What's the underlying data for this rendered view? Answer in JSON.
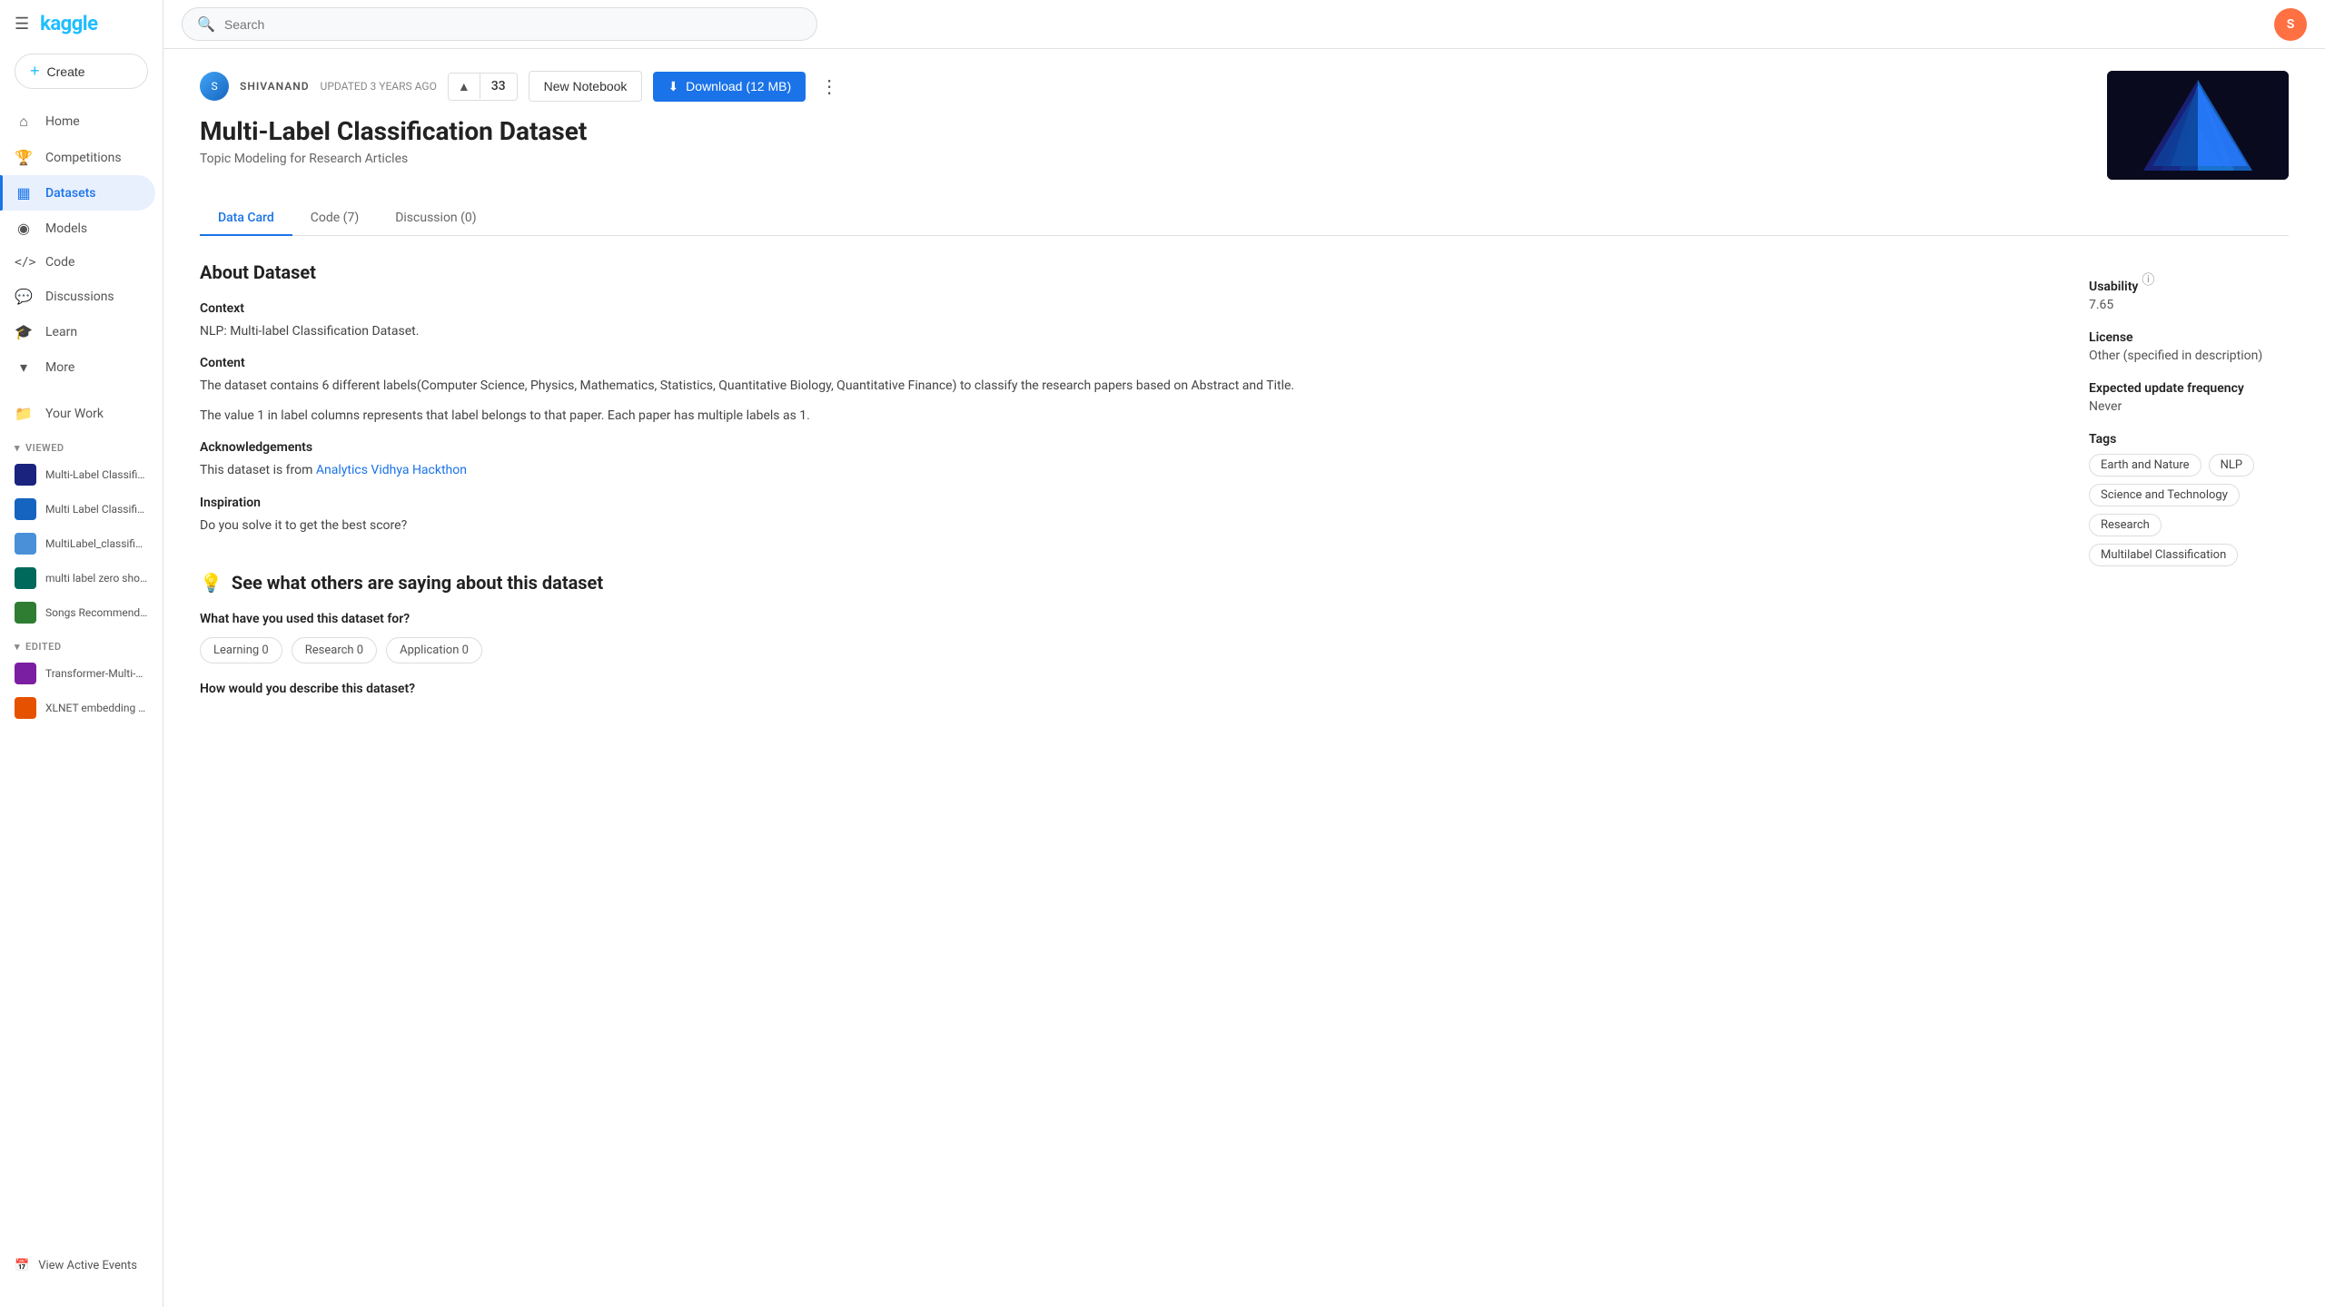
{
  "sidebar": {
    "logo": "kaggle",
    "create_label": "Create",
    "nav_items": [
      {
        "id": "home",
        "label": "Home",
        "icon": "⌂"
      },
      {
        "id": "competitions",
        "label": "Competitions",
        "icon": "🏆"
      },
      {
        "id": "datasets",
        "label": "Datasets",
        "icon": "▦",
        "active": true
      },
      {
        "id": "models",
        "label": "Models",
        "icon": "◉"
      },
      {
        "id": "code",
        "label": "Code",
        "icon": "</>"
      },
      {
        "id": "discussions",
        "label": "Discussions",
        "icon": "💬"
      },
      {
        "id": "learn",
        "label": "Learn",
        "icon": "🎓"
      },
      {
        "id": "more",
        "label": "More",
        "icon": "▾"
      }
    ],
    "your_work_label": "Your Work",
    "viewed_label": "VIEWED",
    "viewed_items": [
      {
        "label": "Multi-Label Classificati..."
      },
      {
        "label": "Multi Label Classifier - ..."
      },
      {
        "label": "MultiLabel_classificati..."
      },
      {
        "label": "multi label zero shot cl..."
      },
      {
        "label": "Songs Recommendatio..."
      }
    ],
    "edited_label": "EDITED",
    "edited_items": [
      {
        "label": "Transformer-Multi-Lab..."
      },
      {
        "label": "XLNET embedding and..."
      }
    ],
    "view_active_events": "View Active Events"
  },
  "topbar": {
    "search_placeholder": "Search"
  },
  "dataset": {
    "owner": "SHIVANAND",
    "updated": "UPDATED 3 YEARS AGO",
    "vote_count": "33",
    "new_notebook_label": "New Notebook",
    "download_label": "Download (12 MB)",
    "title": "Multi-Label Classification Dataset",
    "subtitle": "Topic Modeling for Research Articles",
    "tabs": [
      {
        "id": "data-card",
        "label": "Data Card",
        "active": true
      },
      {
        "id": "code",
        "label": "Code (7)"
      },
      {
        "id": "discussion",
        "label": "Discussion (0)"
      }
    ],
    "about_title": "About Dataset",
    "context_label": "Context",
    "context_text": "NLP: Multi-label Classification Dataset.",
    "content_label": "Content",
    "content_text": "The dataset contains 6 different labels(Computer Science, Physics, Mathematics, Statistics, Quantitative Biology, Quantitative Finance) to classify the research papers based on Abstract and Title.",
    "content_text2": "The value 1 in label columns represents that label belongs to that paper. Each paper has multiple labels as 1.",
    "acknowledgements_label": "Acknowledgements",
    "acknowledgements_text": "This dataset is from Analytics Vidhya Hackthon",
    "acknowledgements_link": "Analytics Vidhya Hackthon",
    "inspiration_label": "Inspiration",
    "inspiration_text": "Do you solve it to get the best score?"
  },
  "sidebar_info": {
    "usability_label": "Usability",
    "usability_value": "7.65",
    "license_label": "License",
    "license_value": "Other (specified in description)",
    "update_freq_label": "Expected update frequency",
    "update_freq_value": "Never",
    "tags_label": "Tags",
    "tags": [
      "Earth and Nature",
      "NLP",
      "Science and Technology",
      "Research",
      "Multilabel Classification"
    ]
  },
  "community": {
    "title": "See what others are saying about this dataset",
    "usage_label": "What have you used this dataset for?",
    "usage_chips": [
      "Learning 0",
      "Research 0",
      "Application 0"
    ],
    "describe_label": "How would you describe this dataset?"
  }
}
